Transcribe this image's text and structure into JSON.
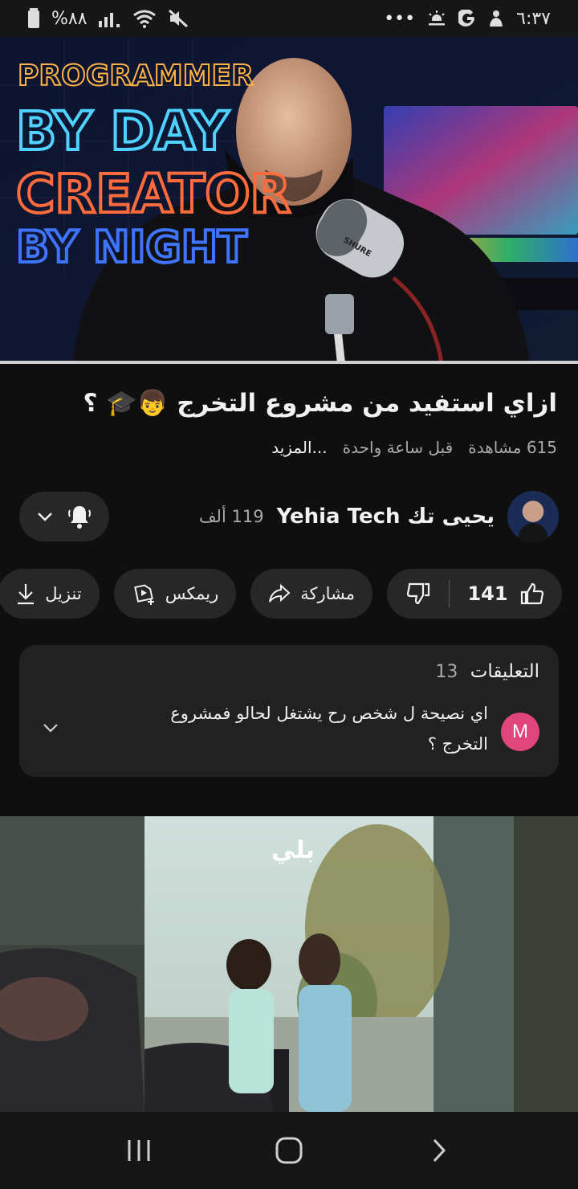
{
  "status_bar": {
    "time": "٦:٣٧",
    "battery": "%٨٨",
    "overflow": "•••",
    "icons": [
      "battery-icon",
      "signal-icon",
      "wifi-icon",
      "mute-icon",
      "weather-icon",
      "google-icon",
      "notification-icon"
    ]
  },
  "video": {
    "overlay_lines": [
      "PROGRAMMER",
      "BY DAY",
      "CREATOR",
      "BY NIGHT"
    ],
    "mic_brand": "SHURE"
  },
  "title": "ازاي استفيد من مشروع التخرج 👦🎓 ؟",
  "meta": {
    "views": "615 مشاهدة",
    "time_ago": "قبل ساعة واحدة",
    "more": "...المزيد"
  },
  "channel": {
    "name": "يحيى تك Yehia Tech",
    "subscribers": "119 ألف"
  },
  "actions": {
    "likes": "141",
    "share": "مشاركة",
    "remix": "ريمكس",
    "download": "تنزيل"
  },
  "comments": {
    "heading": "التعليقات",
    "count": "13",
    "avatar_letter": "M",
    "top_comment": "اي نصيحة ل شخص رح يشتغل لحالو فمشروع التخرج ؟"
  },
  "next_video": {
    "watermark": "بلي"
  },
  "colors": {
    "background": "#0f0f0f",
    "chip": "#272727",
    "comment_avatar": "#e0457b"
  }
}
